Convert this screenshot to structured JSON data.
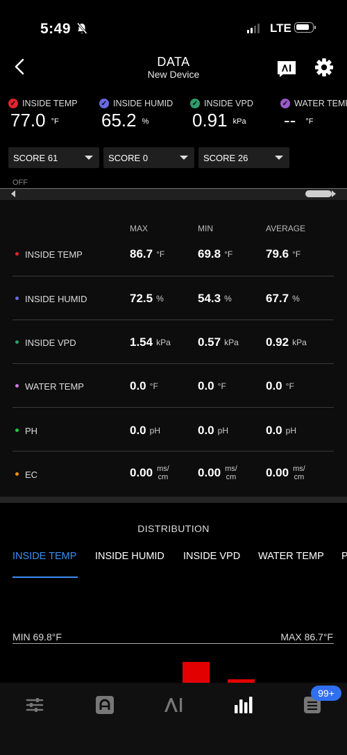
{
  "status_bar": {
    "time": "5:49",
    "network": "LTE"
  },
  "header": {
    "title": "DATA",
    "subtitle": "New Device"
  },
  "sensors": [
    {
      "label": "INSIDE TEMP",
      "value": "77.0",
      "unit": "°F",
      "color": "#e0242e"
    },
    {
      "label": "INSIDE HUMID",
      "value": "65.2",
      "unit": "%",
      "color": "#6b6ae0"
    },
    {
      "label": "INSIDE VPD",
      "value": "0.91",
      "unit": "kPa",
      "color": "#2e9c6c"
    },
    {
      "label": "WATER TEMP",
      "value": "--",
      "unit": "°F",
      "color": "#9b59c9"
    }
  ],
  "scores": [
    "SCORE 61",
    "SCORE 0",
    "SCORE 26"
  ],
  "timeline": {
    "off_label": "OFF"
  },
  "stats": {
    "headers": {
      "max": "MAX",
      "min": "MIN",
      "average": "AVERAGE"
    },
    "rows": [
      {
        "name": "INSIDE TEMP",
        "color": "#e0242e",
        "max": "86.7",
        "min": "69.8",
        "avg": "79.6",
        "unit": "°F"
      },
      {
        "name": "INSIDE HUMID",
        "color": "#6b6ae0",
        "max": "72.5",
        "min": "54.3",
        "avg": "67.7",
        "unit": "%"
      },
      {
        "name": "INSIDE VPD",
        "color": "#2e9c6c",
        "max": "1.54",
        "min": "0.57",
        "avg": "0.92",
        "unit": "kPa"
      },
      {
        "name": "WATER TEMP",
        "color": "#c77ad8",
        "max": "0.0",
        "min": "0.0",
        "avg": "0.0",
        "unit": "°F"
      },
      {
        "name": "PH",
        "color": "#2bbf4a",
        "max": "0.0",
        "min": "0.0",
        "avg": "0.0",
        "unit": "pH"
      },
      {
        "name": "EC",
        "color": "#f0901e",
        "max": "0.00",
        "min": "0.00",
        "avg": "0.00",
        "unit_top": "ms/",
        "unit_bottom": "cm"
      }
    ]
  },
  "distribution": {
    "title": "DISTRIBUTION",
    "tabs": [
      "INSIDE TEMP",
      "INSIDE HUMID",
      "INSIDE VPD",
      "WATER TEMP",
      "P"
    ],
    "active_tab": 0,
    "min_label": "MIN 69.8°F",
    "max_label": "MAX 86.7°F"
  },
  "nav": {
    "badge": "99+",
    "items": [
      "controls-icon",
      "device-icon",
      "ai-icon",
      "data-icon",
      "notes-icon"
    ]
  },
  "colors": {
    "accent": "#3b8ef3",
    "bar": "#e30000",
    "badge": "#2f6ff0"
  }
}
